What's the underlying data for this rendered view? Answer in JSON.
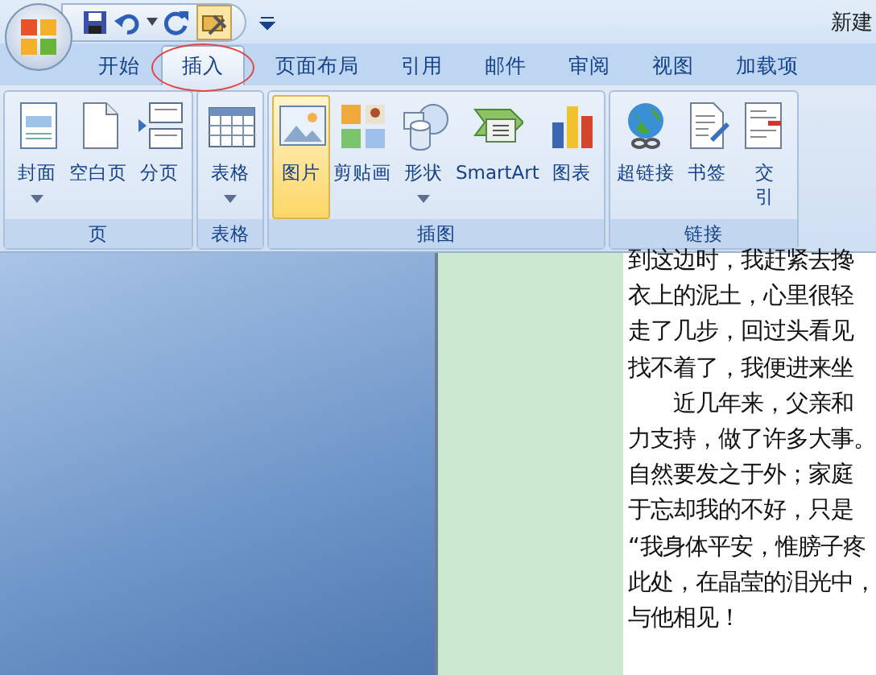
{
  "window": {
    "title": "新建"
  },
  "tabs": [
    {
      "label": "开始",
      "selected": false
    },
    {
      "label": "插入",
      "selected": true
    },
    {
      "label": "页面布局",
      "selected": false
    },
    {
      "label": "引用",
      "selected": false
    },
    {
      "label": "邮件",
      "selected": false
    },
    {
      "label": "审阅",
      "selected": false
    },
    {
      "label": "视图",
      "selected": false
    },
    {
      "label": "加载项",
      "selected": false
    }
  ],
  "groups": [
    {
      "name": "页",
      "buttons": [
        {
          "label": "封面",
          "kind": "cover",
          "dropdown": true,
          "highlighted": false
        },
        {
          "label": "空白页",
          "kind": "blank",
          "dropdown": false,
          "highlighted": false
        },
        {
          "label": "分页",
          "kind": "pagebreak",
          "dropdown": false,
          "highlighted": false
        }
      ]
    },
    {
      "name": "表格",
      "buttons": [
        {
          "label": "表格",
          "kind": "table",
          "dropdown": true,
          "highlighted": false
        }
      ]
    },
    {
      "name": "插图",
      "buttons": [
        {
          "label": "图片",
          "kind": "picture",
          "dropdown": false,
          "highlighted": true
        },
        {
          "label": "剪贴画",
          "kind": "clipart",
          "dropdown": false,
          "highlighted": false
        },
        {
          "label": "形状",
          "kind": "shapes",
          "dropdown": true,
          "highlighted": false
        },
        {
          "label": "SmartArt",
          "kind": "smartart",
          "dropdown": false,
          "highlighted": false
        },
        {
          "label": "图表",
          "kind": "chart",
          "dropdown": false,
          "highlighted": false
        }
      ]
    },
    {
      "name": "链接",
      "buttons": [
        {
          "label": "超链接",
          "kind": "hyperlink",
          "dropdown": false,
          "highlighted": false
        },
        {
          "label": "书签",
          "kind": "bookmark",
          "dropdown": false,
          "highlighted": false
        },
        {
          "label": "交引",
          "kind": "crossref",
          "dropdown": false,
          "highlighted": false
        }
      ]
    }
  ],
  "document": {
    "lines": [
      "到这边时，我赶紧去搀",
      "衣上的泥土，心里很轻",
      "走了几步，回过头看见",
      "找不着了，我便进来坐",
      "　　近几年来，父亲和",
      "力支持，做了许多大事。",
      "自然要发之于外；家庭",
      "于忘却我的不好，只是",
      "“我身体平安，惟膀子疼",
      "此处，在晶莹的泪光中，",
      "与他相见！"
    ]
  }
}
